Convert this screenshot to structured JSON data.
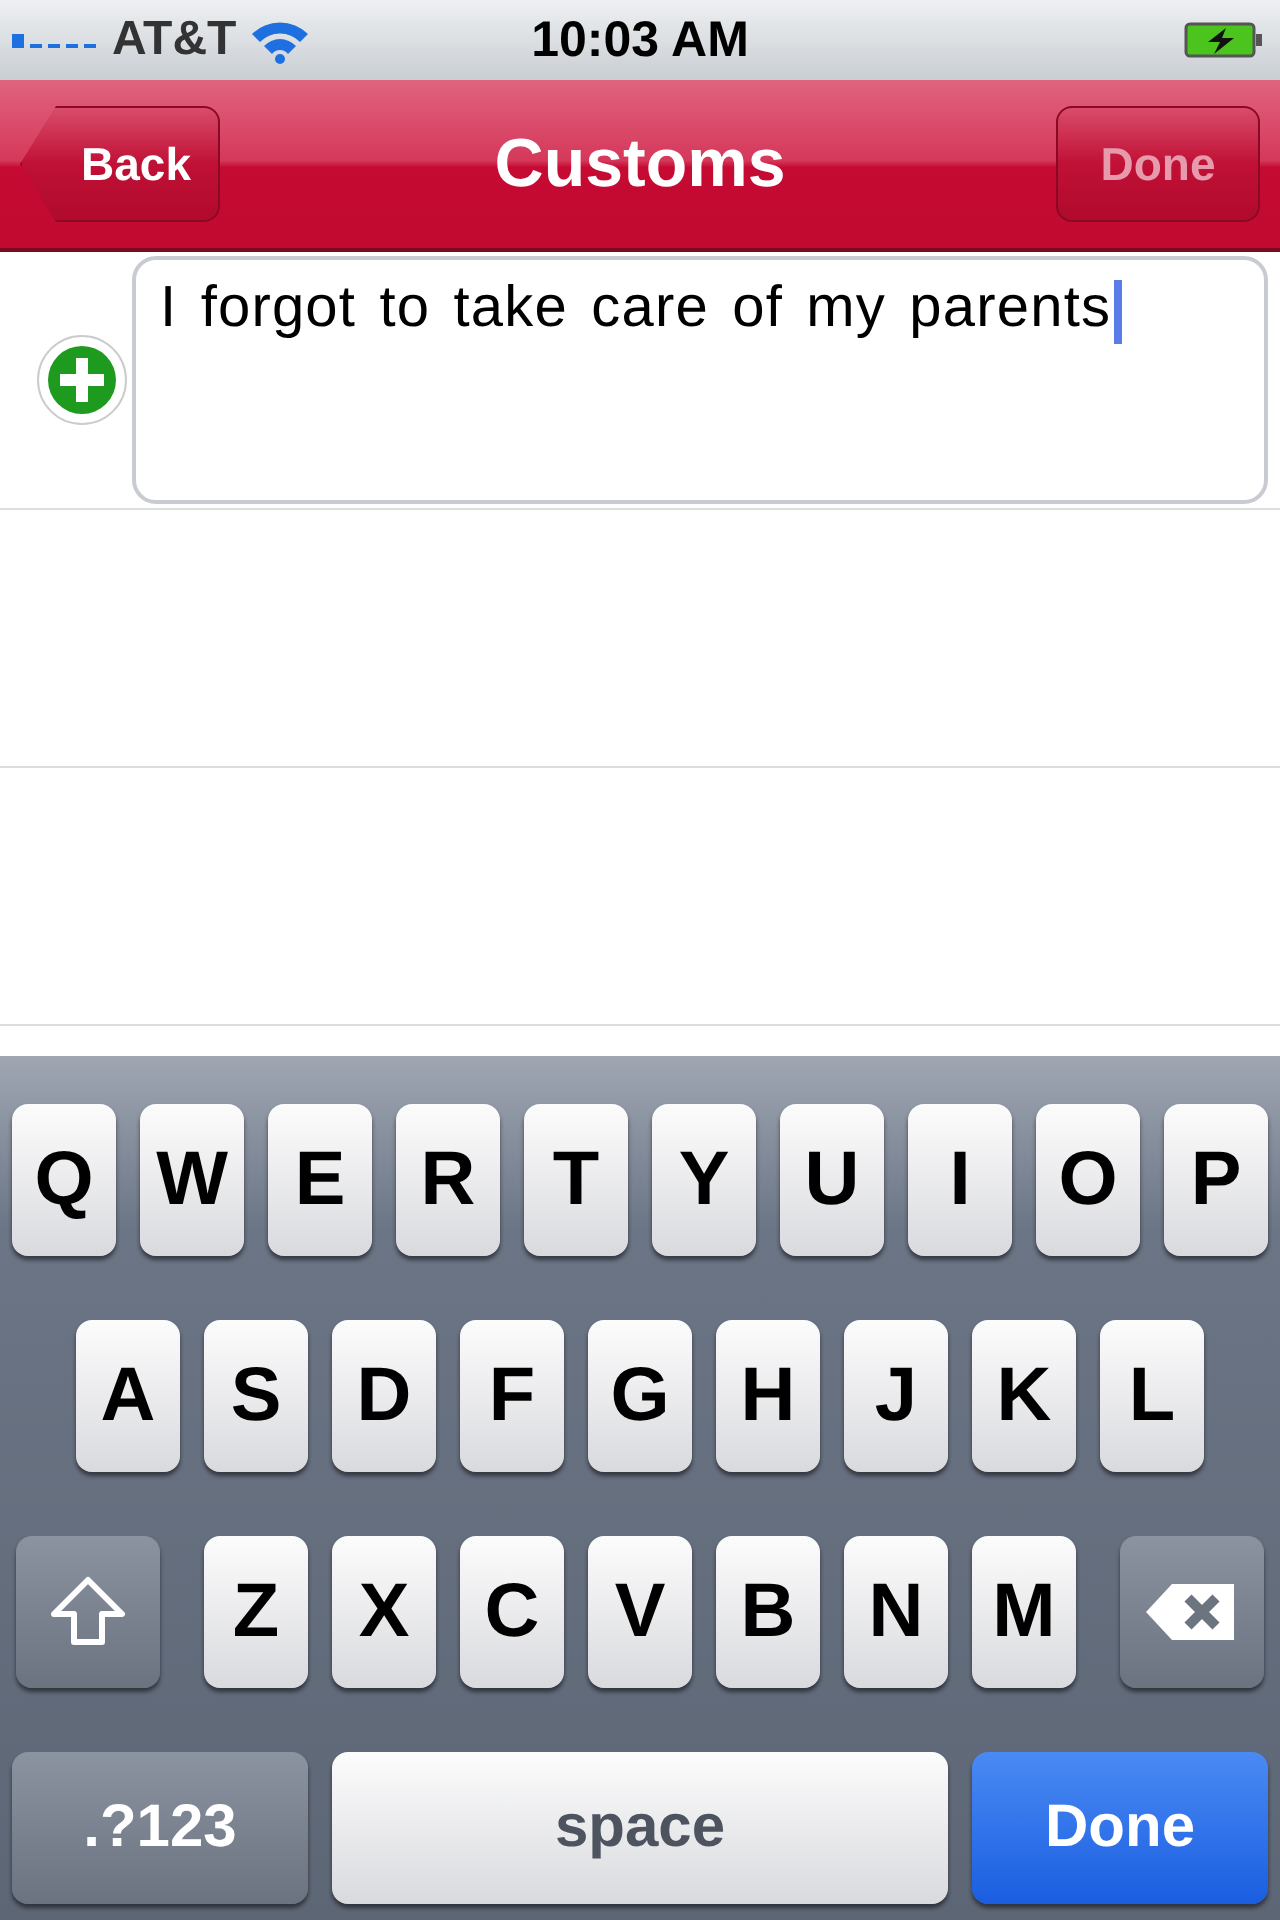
{
  "status_bar": {
    "carrier": "AT&T",
    "time": "10:03 AM"
  },
  "nav_bar": {
    "back": "Back",
    "title": "Customs",
    "done": {
      "label": "Done",
      "disabled": true
    }
  },
  "rows": [
    {
      "kind": "entry",
      "text": "I forgot to take care of my parents"
    },
    {
      "kind": "empty"
    },
    {
      "kind": "empty"
    }
  ],
  "keyboard": {
    "letter_rows": [
      [
        "Q",
        "W",
        "E",
        "R",
        "T",
        "Y",
        "U",
        "I",
        "O",
        "P"
      ],
      [
        "A",
        "S",
        "D",
        "F",
        "G",
        "H",
        "J",
        "K",
        "L"
      ],
      [
        "Z",
        "X",
        "C",
        "V",
        "B",
        "N",
        "M"
      ]
    ],
    "mode_key": ".?123",
    "space_key": "space",
    "return_key": "Done"
  }
}
